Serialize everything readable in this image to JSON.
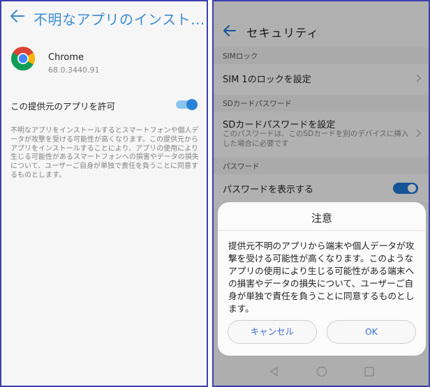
{
  "left": {
    "title": "不明なアプリのインスト...",
    "app": {
      "name": "Chrome",
      "version": "68.0.3440.91"
    },
    "allow_label": "この提供元のアプリを許可",
    "allow_enabled": true,
    "description": "不明なアプリをインストールするとスマートフォンや個人データが攻撃を受ける可能性が高くなります。この提供元からアプリをインストールすることにより、アプリの使用により生じる可能性があるスマートフォンへの損害やデータの損失について、ユーザーご自身が単独で責任を負うことに同意するものとします。"
  },
  "right": {
    "title": "セキュリティ",
    "sections": [
      {
        "header": "SIMロック",
        "row_title": "SIM 1のロックを設定",
        "row_sub": ""
      },
      {
        "header": "SDカードパスワード",
        "row_title": "SDカードパスワードを設定",
        "row_sub": "このパスワードは、このSDカードを別のデバイスに挿入した場合に必要です"
      },
      {
        "header": "パスワード",
        "row_title": "パスワードを表示する",
        "row_sub": ""
      }
    ],
    "show_password_enabled": true,
    "dialog": {
      "title": "注意",
      "body": "提供元不明のアプリから端末や個人データが攻撃を受ける可能性が高くなります。このようなアプリの使用により生じる可能性がある端末への損害やデータの損失について、ユーザーご自身が単独で責任を負うことに同意するものとします。",
      "cancel_label": "キャンセル",
      "ok_label": "OK"
    }
  },
  "colors": {
    "accent": "#1e73d2",
    "left_accent": "#3c8cd0",
    "panel_border": "#3b3fb0"
  },
  "icons": [
    "back-arrow-icon",
    "chrome-icon",
    "chevron-right-icon",
    "nav-back-icon",
    "nav-home-icon",
    "nav-recents-icon"
  ]
}
